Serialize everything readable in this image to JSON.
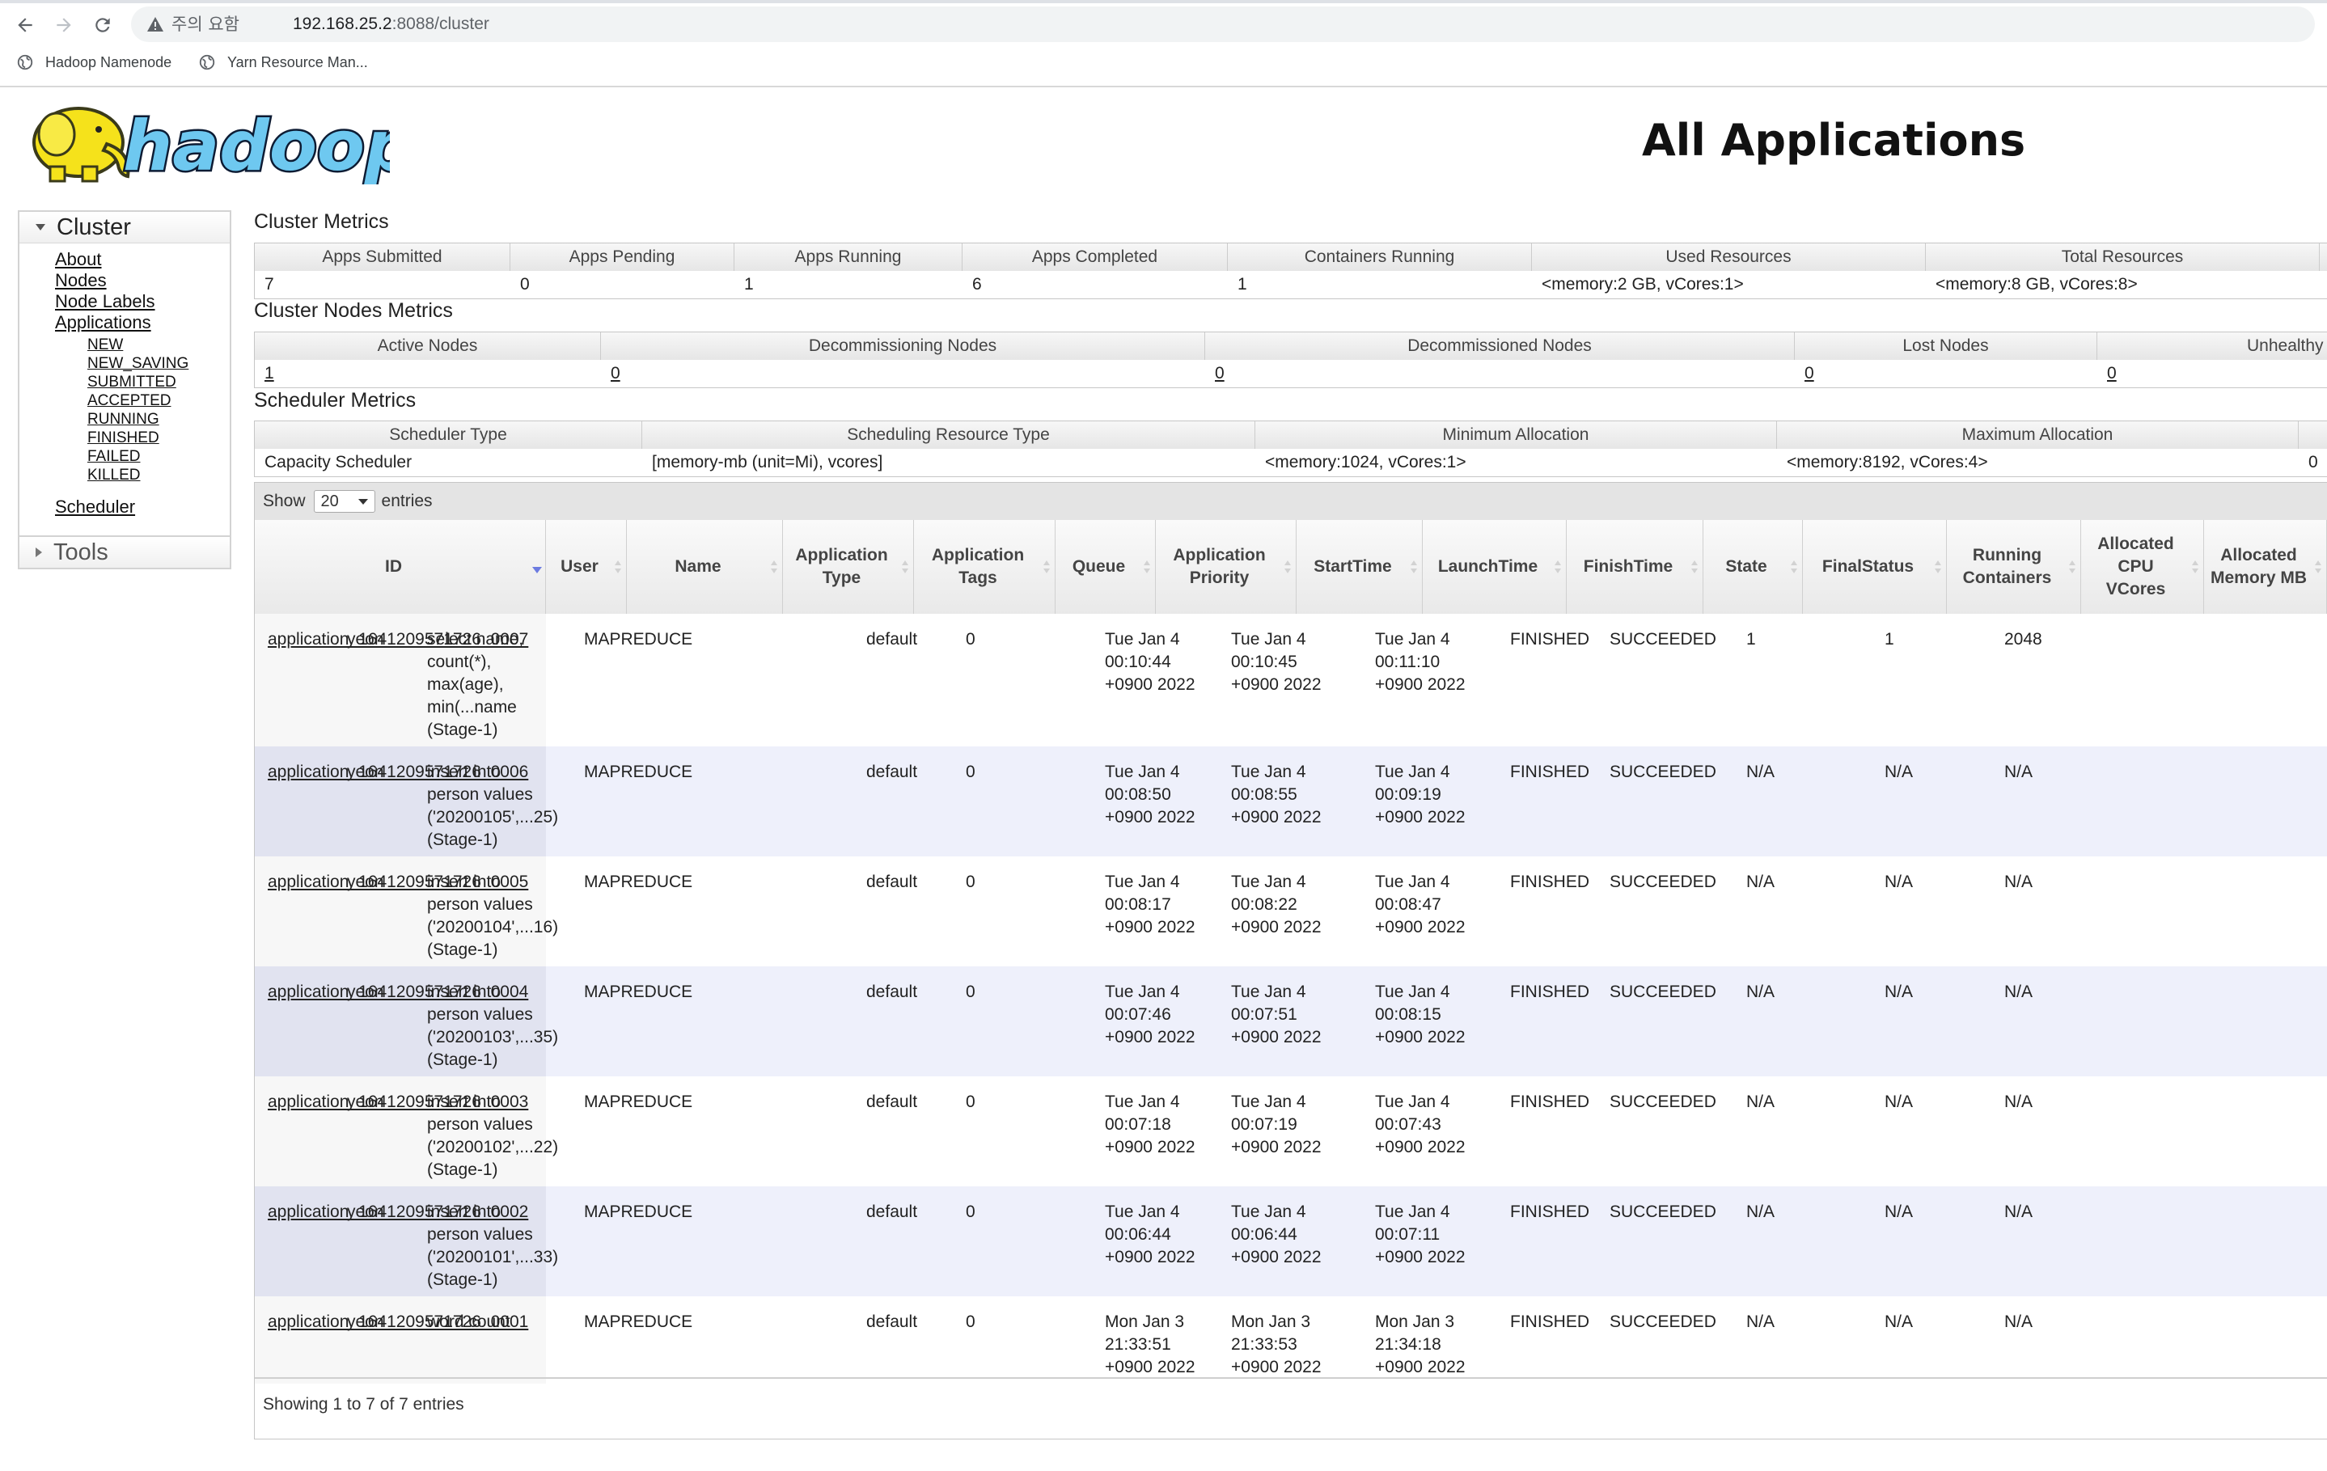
{
  "browser": {
    "security_warning": "주의 요함",
    "url_host": "192.168.25.2",
    "url_rest": ":8088/cluster",
    "bookmarks": [
      "Hadoop Namenode",
      "Yarn Resource Man..."
    ]
  },
  "page": {
    "logo_text": "hadoop",
    "title": "All Applications"
  },
  "sidebar": {
    "cluster_label": "Cluster",
    "links": [
      "About",
      "Nodes",
      "Node Labels",
      "Applications"
    ],
    "app_states": [
      "NEW",
      "NEW_SAVING",
      "SUBMITTED",
      "ACCEPTED",
      "RUNNING",
      "FINISHED",
      "FAILED",
      "KILLED"
    ],
    "scheduler_link": "Scheduler",
    "tools_label": "Tools"
  },
  "cluster_metrics": {
    "title": "Cluster Metrics",
    "headers": [
      "Apps Submitted",
      "Apps Pending",
      "Apps Running",
      "Apps Completed",
      "Containers Running",
      "Used Resources",
      "Total Resources"
    ],
    "values": [
      "7",
      "0",
      "1",
      "6",
      "1",
      "<memory:2 GB, vCores:1>",
      "<memory:8 GB, vCores:8>"
    ]
  },
  "nodes_metrics": {
    "title": "Cluster Nodes Metrics",
    "headers": [
      "Active Nodes",
      "Decommissioning Nodes",
      "Decommissioned Nodes",
      "Lost Nodes",
      "Unhealthy"
    ],
    "values": [
      "1",
      "0",
      "0",
      "0",
      "0"
    ]
  },
  "scheduler_metrics": {
    "title": "Scheduler Metrics",
    "headers": [
      "Scheduler Type",
      "Scheduling Resource Type",
      "Minimum Allocation",
      "Maximum Allocation",
      ""
    ],
    "values": [
      "Capacity Scheduler",
      "[memory-mb (unit=Mi), vcores]",
      "<memory:1024, vCores:1>",
      "<memory:8192, vCores:4>",
      "0"
    ]
  },
  "apps_table": {
    "show_label": "Show",
    "entries_value": "20",
    "entries_label": "entries",
    "columns": [
      "ID",
      "User",
      "Name",
      "Application Type",
      "Application Tags",
      "Queue",
      "Application Priority",
      "StartTime",
      "LaunchTime",
      "FinishTime",
      "State",
      "FinalStatus",
      "Running Containers",
      "Allocated CPU VCores",
      "Allocated Memory MB"
    ],
    "rows": [
      {
        "id": "application_1641209571726_0007",
        "user": "yeon",
        "name": "select name,\ncount(*),\nmax(age),\nmin(...name\n(Stage-1)",
        "type": "MAPREDUCE",
        "tags": "",
        "queue": "default",
        "priority": "0",
        "start": "Tue Jan 4\n00:10:44\n+0900 2022",
        "launch": "Tue Jan 4\n00:10:45\n+0900 2022",
        "finish": "Tue Jan 4\n00:11:10\n+0900 2022",
        "state": "FINISHED",
        "final": "SUCCEEDED",
        "containers": "1",
        "vcores": "1",
        "memory": "2048"
      },
      {
        "id": "application_1641209571726_0006",
        "user": "yeon",
        "name": "insert into\nperson values\n('20200105',...25)\n(Stage-1)",
        "type": "MAPREDUCE",
        "tags": "",
        "queue": "default",
        "priority": "0",
        "start": "Tue Jan 4\n00:08:50\n+0900 2022",
        "launch": "Tue Jan 4\n00:08:55\n+0900 2022",
        "finish": "Tue Jan 4\n00:09:19\n+0900 2022",
        "state": "FINISHED",
        "final": "SUCCEEDED",
        "containers": "N/A",
        "vcores": "N/A",
        "memory": "N/A"
      },
      {
        "id": "application_1641209571726_0005",
        "user": "yeon",
        "name": "insert into\nperson values\n('20200104',...16)\n(Stage-1)",
        "type": "MAPREDUCE",
        "tags": "",
        "queue": "default",
        "priority": "0",
        "start": "Tue Jan 4\n00:08:17\n+0900 2022",
        "launch": "Tue Jan 4\n00:08:22\n+0900 2022",
        "finish": "Tue Jan 4\n00:08:47\n+0900 2022",
        "state": "FINISHED",
        "final": "SUCCEEDED",
        "containers": "N/A",
        "vcores": "N/A",
        "memory": "N/A"
      },
      {
        "id": "application_1641209571726_0004",
        "user": "yeon",
        "name": "insert into\nperson values\n('20200103',...35)\n(Stage-1)",
        "type": "MAPREDUCE",
        "tags": "",
        "queue": "default",
        "priority": "0",
        "start": "Tue Jan 4\n00:07:46\n+0900 2022",
        "launch": "Tue Jan 4\n00:07:51\n+0900 2022",
        "finish": "Tue Jan 4\n00:08:15\n+0900 2022",
        "state": "FINISHED",
        "final": "SUCCEEDED",
        "containers": "N/A",
        "vcores": "N/A",
        "memory": "N/A"
      },
      {
        "id": "application_1641209571726_0003",
        "user": "yeon",
        "name": "insert into\nperson values\n('20200102',...22)\n(Stage-1)",
        "type": "MAPREDUCE",
        "tags": "",
        "queue": "default",
        "priority": "0",
        "start": "Tue Jan 4\n00:07:18\n+0900 2022",
        "launch": "Tue Jan 4\n00:07:19\n+0900 2022",
        "finish": "Tue Jan 4\n00:07:43\n+0900 2022",
        "state": "FINISHED",
        "final": "SUCCEEDED",
        "containers": "N/A",
        "vcores": "N/A",
        "memory": "N/A"
      },
      {
        "id": "application_1641209571726_0002",
        "user": "yeon",
        "name": "insert into\nperson values\n('20200101',...33)\n(Stage-1)",
        "type": "MAPREDUCE",
        "tags": "",
        "queue": "default",
        "priority": "0",
        "start": "Tue Jan 4\n00:06:44\n+0900 2022",
        "launch": "Tue Jan 4\n00:06:44\n+0900 2022",
        "finish": "Tue Jan 4\n00:07:11\n+0900 2022",
        "state": "FINISHED",
        "final": "SUCCEEDED",
        "containers": "N/A",
        "vcores": "N/A",
        "memory": "N/A"
      },
      {
        "id": "application_1641209571726_0001",
        "user": "yeon",
        "name": "word count",
        "type": "MAPREDUCE",
        "tags": "",
        "queue": "default",
        "priority": "0",
        "start": "Mon Jan 3\n21:33:51\n+0900 2022",
        "launch": "Mon Jan 3\n21:33:53\n+0900 2022",
        "finish": "Mon Jan 3\n21:34:18\n+0900 2022",
        "state": "FINISHED",
        "final": "SUCCEEDED",
        "containers": "N/A",
        "vcores": "N/A",
        "memory": "N/A"
      }
    ],
    "info": "Showing 1 to 7 of 7 entries"
  }
}
